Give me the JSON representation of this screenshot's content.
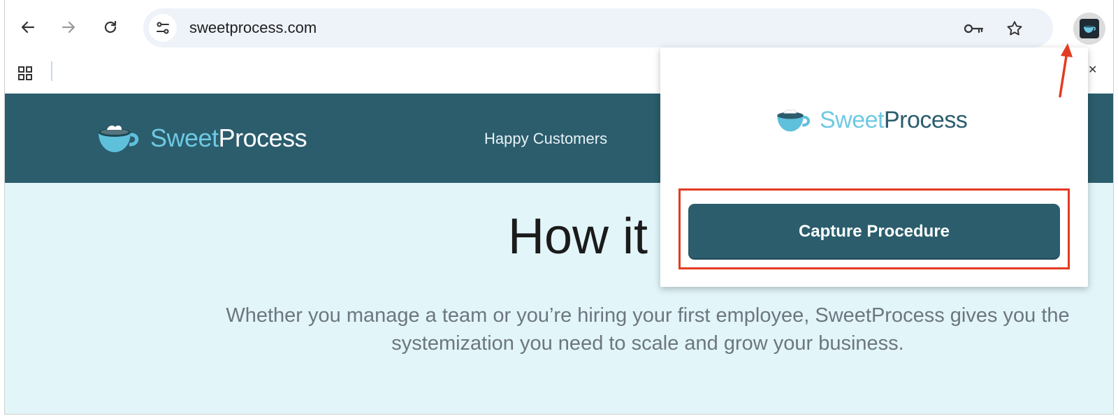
{
  "browser": {
    "url": "sweetprocess.com",
    "icons": {
      "back": "arrow-left-icon",
      "forward": "arrow-right-icon",
      "reload": "reload-icon",
      "site_info": "tune-icon",
      "password": "key-icon",
      "bookmark": "star-icon",
      "extension": "sweetprocess-extension-icon",
      "apps": "apps-grid-icon"
    }
  },
  "site": {
    "logo": {
      "sweet": "Sweet",
      "process": "Process"
    },
    "nav": {
      "happy_customers": "Happy Customers"
    },
    "hero": {
      "title": "How it w",
      "subtitle": "Whether you manage a team or you’re hiring your first employee, SweetProcess gives you the systemization you need to scale and grow your business."
    }
  },
  "popup": {
    "logo": {
      "sweet": "Sweet",
      "process": "Process"
    },
    "capture_button": "Capture Procedure"
  },
  "colors": {
    "brand_dark": "#2b5d6d",
    "brand_light": "#6ec9e3",
    "hero_bg": "#e2f5f8",
    "annotation": "#e33b22"
  }
}
